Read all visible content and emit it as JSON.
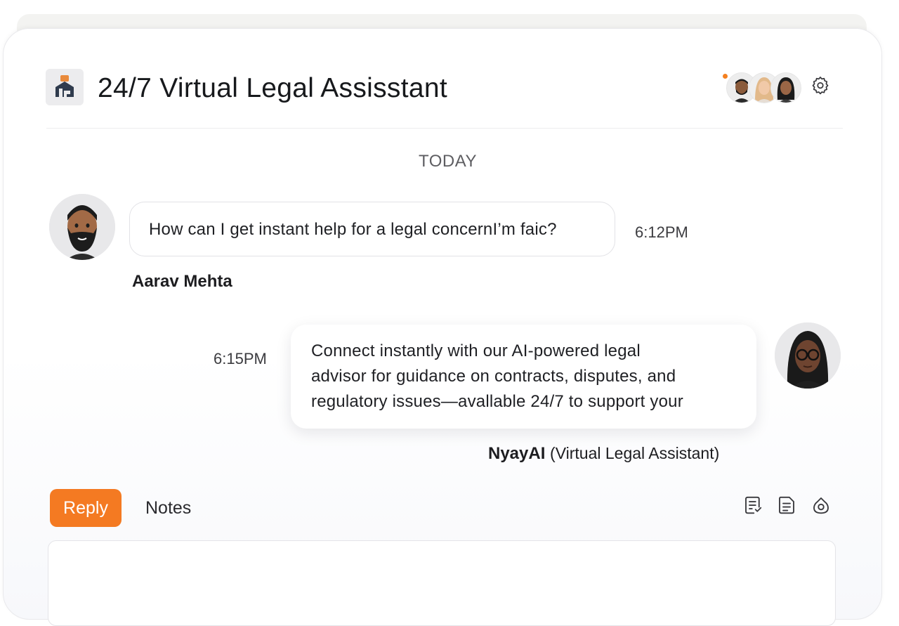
{
  "header": {
    "title": "24/7 Virtual Legal Assisstant",
    "logo_icon": "law-firm-building-icon",
    "presence_color": "#f4801f",
    "participants": [
      "participant-avatar-man",
      "participant-avatar-woman-blonde",
      "participant-avatar-woman-dark"
    ],
    "settings_icon": "gear-icon"
  },
  "conversation": {
    "date_separator": "TODAY",
    "messages": [
      {
        "sender": "Aarav Mehta",
        "text": "How can I get instant help for a legal concernI’m faic?",
        "time": "6:12PM"
      },
      {
        "sender_name": "NyayAI",
        "sender_role": "(Virtual Legal Assistant)",
        "lines": [
          "Connect instantly with our AI-powered legal",
          "advisor for guidance on contracts, disputes, and",
          "regulatory issues—avallable 24/7 to support your"
        ],
        "time": "6:15PM"
      }
    ]
  },
  "composer": {
    "tabs": {
      "reply": "Reply",
      "notes": "Notes"
    },
    "accent": "#f47a22",
    "tools": [
      "template-icon",
      "document-icon",
      "attachment-icon"
    ],
    "input_value": ""
  }
}
